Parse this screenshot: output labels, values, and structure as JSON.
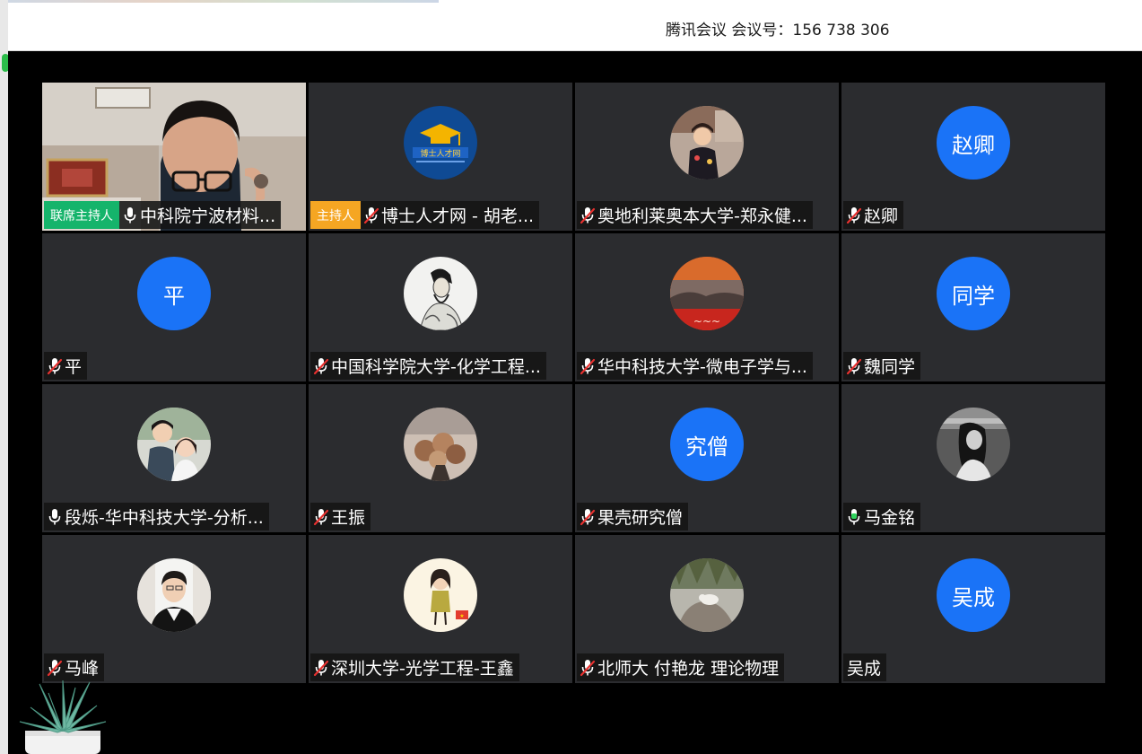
{
  "window": {
    "title": "腾讯会议 会议号：156 738 306"
  },
  "participants": [
    {
      "name": "中科院宁波材料...",
      "mic": "on",
      "badge": "联席主持人",
      "badge_type": "cohost",
      "avatar": "video-feed",
      "avatar_icon": "person-video"
    },
    {
      "name": "博士人才网 - 胡老...",
      "mic": "muted",
      "badge": "主持人",
      "badge_type": "host",
      "avatar": "image",
      "avatar_icon": "graduation-cap-logo",
      "avatar_text": "博士人才网"
    },
    {
      "name": "奥地利莱奥本大学-郑永健...",
      "mic": "muted",
      "avatar": "image",
      "avatar_icon": "child-photo"
    },
    {
      "name": "赵卿",
      "mic": "muted",
      "avatar": "text",
      "avatar_text": "赵卿"
    },
    {
      "name": "平",
      "mic": "muted",
      "avatar": "text",
      "avatar_text": "平"
    },
    {
      "name": "中国科学院大学-化学工程...",
      "mic": "muted",
      "avatar": "image",
      "avatar_icon": "ink-portrait"
    },
    {
      "name": "华中科技大学-微电子学与...",
      "mic": "muted",
      "avatar": "image",
      "avatar_icon": "sunset-photo"
    },
    {
      "name": "魏同学",
      "mic": "muted",
      "avatar": "text",
      "avatar_text": "同学"
    },
    {
      "name": "段烁-华中科技大学-分析...",
      "mic": "on",
      "avatar": "image",
      "avatar_icon": "couple-photo"
    },
    {
      "name": "王振",
      "mic": "muted",
      "avatar": "image",
      "avatar_icon": "flowers-photo"
    },
    {
      "name": "果壳研究僧",
      "mic": "muted",
      "avatar": "text",
      "avatar_text": "究僧"
    },
    {
      "name": "马金铭",
      "mic": "speaking",
      "avatar": "image",
      "avatar_icon": "bw-portrait"
    },
    {
      "name": "马峰",
      "mic": "muted",
      "avatar": "image",
      "avatar_icon": "man-portrait"
    },
    {
      "name": "深圳大学-光学工程-王鑫",
      "mic": "muted",
      "avatar": "image",
      "avatar_icon": "cartoon-girl"
    },
    {
      "name": "北师大 付艳龙 理论物理",
      "mic": "muted",
      "avatar": "image",
      "avatar_icon": "rock-photo"
    },
    {
      "name": "吴成",
      "mic": "none",
      "avatar": "text",
      "avatar_text": "吴成"
    }
  ],
  "colors": {
    "tile_bg": "#2b2c2f",
    "avatar_blue": "#1a73f7",
    "host_badge": "#f5a623",
    "cohost_badge": "#15b46b",
    "muted_red": "#e8312f",
    "speaking_green": "#2fd35d"
  },
  "desktop": {
    "decoration_icon": "succulent-plant-icon"
  }
}
